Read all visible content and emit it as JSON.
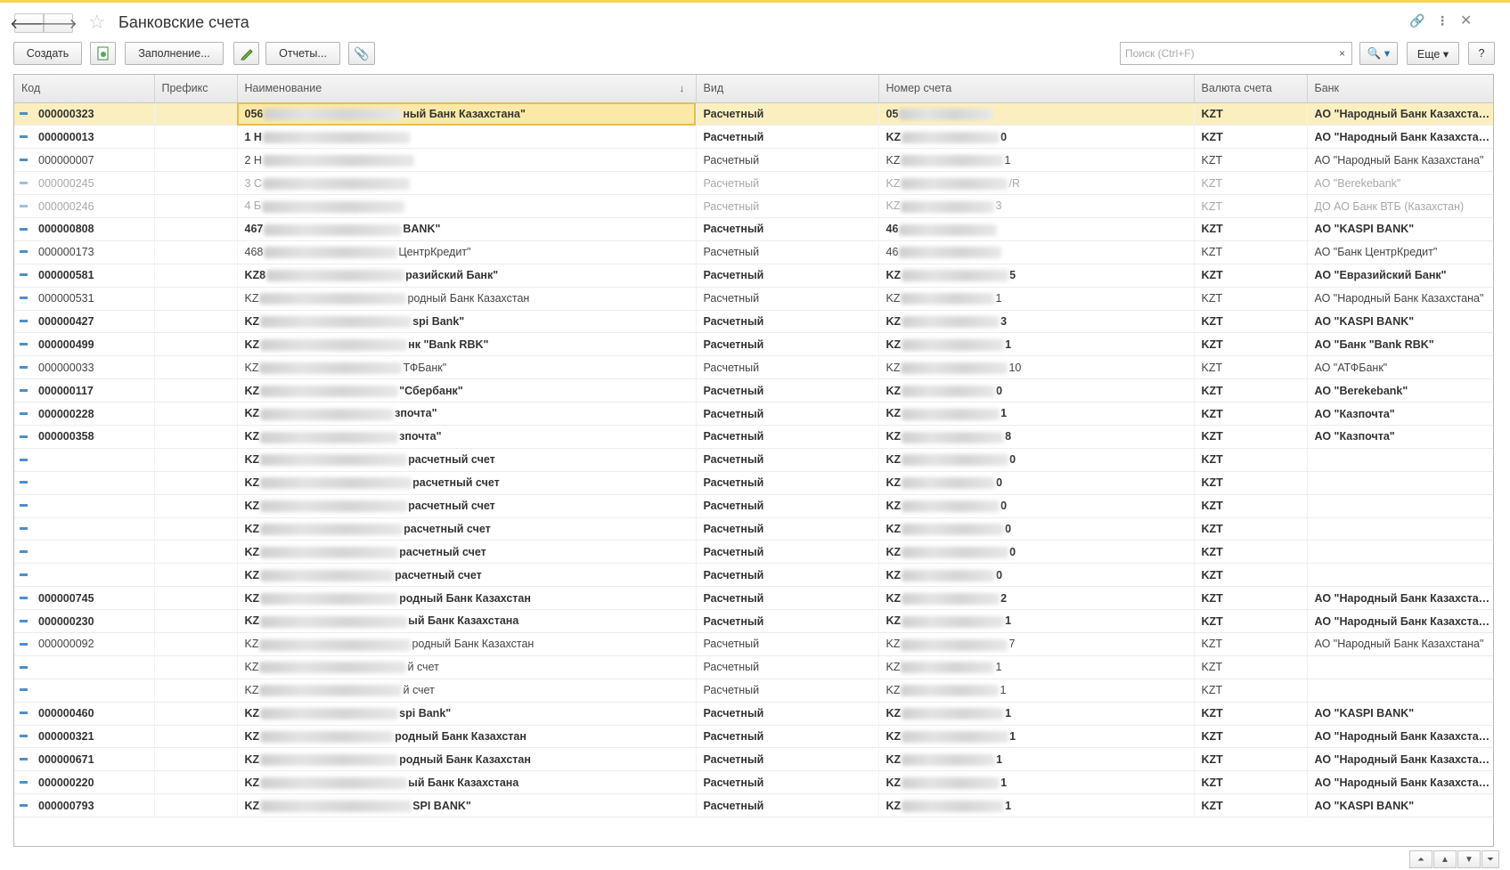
{
  "window": {
    "title": "Банковские счета",
    "icons": {
      "back": "arrow-left-icon",
      "forward": "arrow-right-icon",
      "favorite": "star-icon",
      "link": "link-icon",
      "more": "kebab-menu-icon",
      "close": "close-icon"
    }
  },
  "toolbar": {
    "create_label": "Создать",
    "fill_label": "Заполнение...",
    "reports_label": "Отчеты...",
    "search_placeholder": "Поиск (Ctrl+F)",
    "search_clear": "×",
    "search_button": "🔍 ▾",
    "more_label": "Еще ▾",
    "help_label": "?"
  },
  "table": {
    "columns": [
      "Код",
      "Префикс",
      "Наименование",
      "Вид",
      "Номер счета",
      "Валюта счета",
      "Банк"
    ],
    "sort_indicator": "↓",
    "rows": [
      {
        "style": "bold",
        "selected": true,
        "code": "000000323",
        "prefix": "",
        "name_start": "056",
        "name_end": "ный Банк Казахстана\"",
        "kind": "Расчетный",
        "acct_start": "05",
        "acct_end": "",
        "currency": "KZT",
        "bank": "АО \"Народный Банк Казахстана\""
      },
      {
        "style": "bold",
        "code": "000000013",
        "prefix": "",
        "name_start": "1 Н",
        "name_end": "",
        "kind": "Расчетный",
        "acct_start": "KZ",
        "acct_end": "0",
        "currency": "KZT",
        "bank": "АО \"Народный Банк Казахстана\""
      },
      {
        "style": "normal",
        "code": "000000007",
        "prefix": "",
        "name_start": "2 Н",
        "name_end": "",
        "kind": "Расчетный",
        "acct_start": "KZ",
        "acct_end": "1",
        "currency": "KZT",
        "bank": "АО \"Народный Банк Казахстана\""
      },
      {
        "style": "gray",
        "code": "000000245",
        "prefix": "",
        "name_start": "3 С",
        "name_end": "",
        "kind": "Расчетный",
        "acct_start": "KZ",
        "acct_end": "/R",
        "currency": "KZT",
        "bank": "АО \"Berekebank\""
      },
      {
        "style": "gray",
        "code": "000000246",
        "prefix": "",
        "name_start": "4 Б",
        "name_end": "",
        "kind": "Расчетный",
        "acct_start": "KZ",
        "acct_end": "3",
        "currency": "KZT",
        "bank": "ДО АО Банк ВТБ (Казахстан)"
      },
      {
        "style": "bold",
        "code": "000000808",
        "prefix": "",
        "name_start": "467",
        "name_end": "BANK\"",
        "kind": "Расчетный",
        "acct_start": "46",
        "acct_end": "",
        "currency": "KZT",
        "bank": "АО \"KASPI BANK\""
      },
      {
        "style": "normal",
        "code": "000000173",
        "prefix": "",
        "name_start": "468",
        "name_end": "ЦентрКредит\"",
        "kind": "Расчетный",
        "acct_start": "46",
        "acct_end": "",
        "currency": "KZT",
        "bank": "АО \"Банк ЦентрКредит\""
      },
      {
        "style": "bold",
        "code": "000000581",
        "prefix": "",
        "name_start": "KZ8",
        "name_end": "разийский Банк\"",
        "kind": "Расчетный",
        "acct_start": "KZ",
        "acct_end": "5",
        "currency": "KZT",
        "bank": "АО \"Евразийский Банк\""
      },
      {
        "style": "normal",
        "code": "000000531",
        "prefix": "",
        "name_start": "KZ",
        "name_end": "родный Банк Казахстан",
        "kind": "Расчетный",
        "acct_start": "KZ",
        "acct_end": "1",
        "currency": "KZT",
        "bank": "АО \"Народный Банк Казахстана\""
      },
      {
        "style": "bold",
        "code": "000000427",
        "prefix": "",
        "name_start": "KZ",
        "name_end": "spi Bank\"",
        "kind": "Расчетный",
        "acct_start": "KZ",
        "acct_end": "3",
        "currency": "KZT",
        "bank": "АО \"KASPI BANK\""
      },
      {
        "style": "bold",
        "code": "000000499",
        "prefix": "",
        "name_start": "KZ",
        "name_end": "нк \"Bank RBK\"",
        "kind": "Расчетный",
        "acct_start": "KZ",
        "acct_end": "1",
        "currency": "KZT",
        "bank": "АО \"Банк \"Bank RBK\""
      },
      {
        "style": "normal",
        "code": "000000033",
        "prefix": "",
        "name_start": "KZ",
        "name_end": "ТФБанк\"",
        "kind": "Расчетный",
        "acct_start": "KZ",
        "acct_end": "10",
        "currency": "KZT",
        "bank": "АО \"АТФБанк\""
      },
      {
        "style": "bold",
        "code": "000000117",
        "prefix": "",
        "name_start": "KZ",
        "name_end": "\"Сбербанк\"",
        "kind": "Расчетный",
        "acct_start": "KZ",
        "acct_end": "0",
        "currency": "KZT",
        "bank": "АО \"Berekebank\""
      },
      {
        "style": "bold",
        "code": "000000228",
        "prefix": "",
        "name_start": "KZ",
        "name_end": "зпочта\"",
        "kind": "Расчетный",
        "acct_start": "KZ",
        "acct_end": "1",
        "currency": "KZT",
        "bank": "АО \"Казпочта\""
      },
      {
        "style": "bold",
        "code": "000000358",
        "prefix": "",
        "name_start": "KZ",
        "name_end": "зпочта\"",
        "kind": "Расчетный",
        "acct_start": "KZ",
        "acct_end": "8",
        "currency": "KZT",
        "bank": "АО \"Казпочта\""
      },
      {
        "style": "bold",
        "code": "",
        "prefix": "",
        "name_start": "KZ",
        "name_end": "расчетный счет",
        "kind": "Расчетный",
        "acct_start": "KZ",
        "acct_end": "0",
        "currency": "KZT",
        "bank": ""
      },
      {
        "style": "bold",
        "code": "",
        "prefix": "",
        "name_start": "KZ",
        "name_end": "расчетный счет",
        "kind": "Расчетный",
        "acct_start": "KZ",
        "acct_end": "0",
        "currency": "KZT",
        "bank": ""
      },
      {
        "style": "bold",
        "code": "",
        "prefix": "",
        "name_start": "KZ",
        "name_end": "расчетный счет",
        "kind": "Расчетный",
        "acct_start": "KZ",
        "acct_end": "0",
        "currency": "KZT",
        "bank": ""
      },
      {
        "style": "bold",
        "code": "",
        "prefix": "",
        "name_start": "KZ",
        "name_end": "расчетный счет",
        "kind": "Расчетный",
        "acct_start": "KZ",
        "acct_end": "0",
        "currency": "KZT",
        "bank": ""
      },
      {
        "style": "bold",
        "code": "",
        "prefix": "",
        "name_start": "KZ",
        "name_end": "расчетный счет",
        "kind": "Расчетный",
        "acct_start": "KZ",
        "acct_end": "0",
        "currency": "KZT",
        "bank": ""
      },
      {
        "style": "bold",
        "code": "",
        "prefix": "",
        "name_start": "KZ",
        "name_end": "расчетный счет",
        "kind": "Расчетный",
        "acct_start": "KZ",
        "acct_end": "0",
        "currency": "KZT",
        "bank": ""
      },
      {
        "style": "bold",
        "code": "000000745",
        "prefix": "",
        "name_start": "KZ",
        "name_end": "родный Банк Казахстан",
        "kind": "Расчетный",
        "acct_start": "KZ",
        "acct_end": "2",
        "currency": "KZT",
        "bank": "АО \"Народный Банк Казахстана\""
      },
      {
        "style": "bold",
        "code": "000000230",
        "prefix": "",
        "name_start": "KZ",
        "name_end": "ый Банк Казахстана",
        "kind": "Расчетный",
        "acct_start": "KZ",
        "acct_end": "1",
        "currency": "KZT",
        "bank": "АО \"Народный Банк Казахстана\""
      },
      {
        "style": "normal",
        "code": "000000092",
        "prefix": "",
        "name_start": "KZ",
        "name_end": "родный Банк Казахстан",
        "kind": "Расчетный",
        "acct_start": "KZ",
        "acct_end": "7",
        "currency": "KZT",
        "bank": "АО \"Народный Банк Казахстана\""
      },
      {
        "style": "normal",
        "code": "",
        "prefix": "",
        "name_start": "KZ",
        "name_end": "й счет",
        "kind": "Расчетный",
        "acct_start": "KZ",
        "acct_end": "1",
        "currency": "KZT",
        "bank": ""
      },
      {
        "style": "normal",
        "code": "",
        "prefix": "",
        "name_start": "KZ",
        "name_end": "й счет",
        "kind": "Расчетный",
        "acct_start": "KZ",
        "acct_end": "1",
        "currency": "KZT",
        "bank": ""
      },
      {
        "style": "bold",
        "code": "000000460",
        "prefix": "",
        "name_start": "KZ",
        "name_end": "spi Bank\"",
        "kind": "Расчетный",
        "acct_start": "KZ",
        "acct_end": "1",
        "currency": "KZT",
        "bank": "АО \"KASPI BANK\""
      },
      {
        "style": "bold",
        "code": "000000321",
        "prefix": "",
        "name_start": "KZ",
        "name_end": "родный Банк Казахстан",
        "kind": "Расчетный",
        "acct_start": "KZ",
        "acct_end": "1",
        "currency": "KZT",
        "bank": "АО \"Народный Банк Казахстана\""
      },
      {
        "style": "bold",
        "code": "000000671",
        "prefix": "",
        "name_start": "KZ",
        "name_end": "родный Банк Казахстан",
        "kind": "Расчетный",
        "acct_start": "KZ",
        "acct_end": "1",
        "currency": "KZT",
        "bank": "АО \"Народный Банк Казахстана\""
      },
      {
        "style": "bold",
        "code": "000000220",
        "prefix": "",
        "name_start": "KZ",
        "name_end": "ый Банк Казахстана",
        "kind": "Расчетный",
        "acct_start": "KZ",
        "acct_end": "1",
        "currency": "KZT",
        "bank": "АО \"Народный Банк Казахстана\""
      },
      {
        "style": "bold",
        "code": "000000793",
        "prefix": "",
        "name_start": "KZ",
        "name_end": "SPI BANK\"",
        "kind": "Расчетный",
        "acct_start": "KZ",
        "acct_end": "1",
        "currency": "KZT",
        "bank": "АО \"KASPI BANK\""
      }
    ]
  },
  "bottom_nav": {
    "first": "⏶",
    "up": "▲",
    "down": "▼",
    "last": "⏷"
  },
  "colors": {
    "accent_border": "#f3d54f",
    "selection": "#fcefbf",
    "row_marker": "#4f8ec6"
  }
}
